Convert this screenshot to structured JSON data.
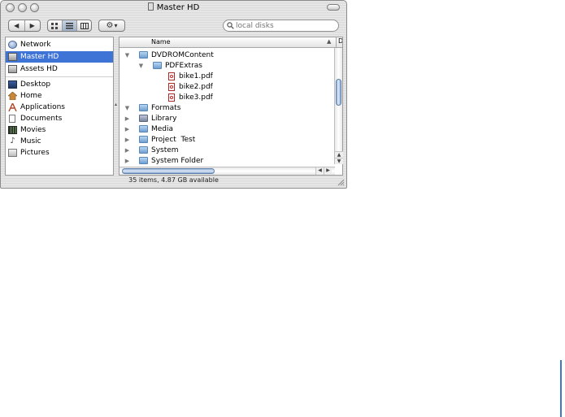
{
  "window": {
    "title": "Master HD"
  },
  "toolbar": {
    "back_label": "◀",
    "forward_label": "▶",
    "view_icons": [
      "icon-view-icon",
      "list-view-icon",
      "column-view-icon"
    ],
    "action_label": "▾",
    "search_placeholder": "local disks"
  },
  "sidebar": {
    "devices": [
      {
        "label": "Network",
        "icon": "network-icon",
        "selected": false
      },
      {
        "label": "Master HD",
        "icon": "hard-disk-icon",
        "selected": true
      },
      {
        "label": "Assets HD",
        "icon": "hard-disk-icon",
        "selected": false
      }
    ],
    "places": [
      {
        "label": "Desktop",
        "icon": "desktop-icon"
      },
      {
        "label": "Home",
        "icon": "home-icon"
      },
      {
        "label": "Applications",
        "icon": "applications-icon"
      },
      {
        "label": "Documents",
        "icon": "documents-icon"
      },
      {
        "label": "Movies",
        "icon": "movies-icon"
      },
      {
        "label": "Music",
        "icon": "music-icon"
      },
      {
        "label": "Pictures",
        "icon": "pictures-icon"
      }
    ]
  },
  "list": {
    "column_name": "Name",
    "sort_indicator": "▲",
    "rows": [
      {
        "label": "DVDROMContent",
        "kind": "folder",
        "level": 0,
        "expanded": true
      },
      {
        "label": "PDFExtras",
        "kind": "folder",
        "level": 1,
        "expanded": true
      },
      {
        "label": "bike1.pdf",
        "kind": "pdf",
        "level": 2
      },
      {
        "label": "bike2.pdf",
        "kind": "pdf",
        "level": 2
      },
      {
        "label": "bike3.pdf",
        "kind": "pdf",
        "level": 2
      },
      {
        "label": "Formats",
        "kind": "folder",
        "level": 0,
        "expanded": true
      },
      {
        "label": "Library",
        "kind": "library",
        "level": 0,
        "expanded": false
      },
      {
        "label": "Media",
        "kind": "folder",
        "level": 0,
        "expanded": false
      },
      {
        "label": "Project  Test",
        "kind": "folder",
        "level": 0,
        "expanded": false
      },
      {
        "label": "System",
        "kind": "folder",
        "level": 0,
        "expanded": false
      },
      {
        "label": "System Folder",
        "kind": "folder",
        "level": 0,
        "expanded": false
      }
    ]
  },
  "status": {
    "text": "35 items, 4.87 GB available"
  }
}
